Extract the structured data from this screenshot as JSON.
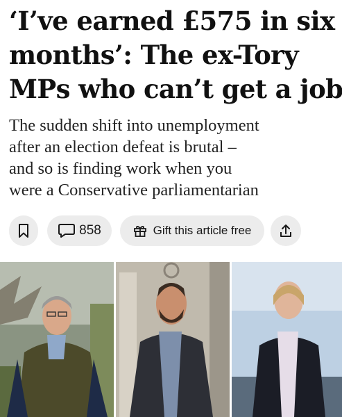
{
  "article": {
    "headline_lines": [
      "‘I’ve earned £575 in six",
      "months’: The ex-Tory",
      "MPs who can’t get a job"
    ],
    "standfirst_lines": [
      "The sudden shift into unemployment",
      "after an election defeat is brutal –",
      "and so is finding work when you",
      "were a Conservative parliamentarian"
    ]
  },
  "actions": {
    "bookmark_icon": "bookmark-icon",
    "comment_icon": "comment-icon",
    "comment_count": "858",
    "gift_icon": "gift-icon",
    "gift_label": "Gift this article free",
    "share_icon": "share-icon"
  },
  "photos": [
    {
      "subject": "man-in-green-gilet"
    },
    {
      "subject": "man-in-blue-suit"
    },
    {
      "subject": "woman-in-dark-blazer"
    }
  ],
  "colors": {
    "text": "#111111",
    "pill_background": "#ececec"
  }
}
